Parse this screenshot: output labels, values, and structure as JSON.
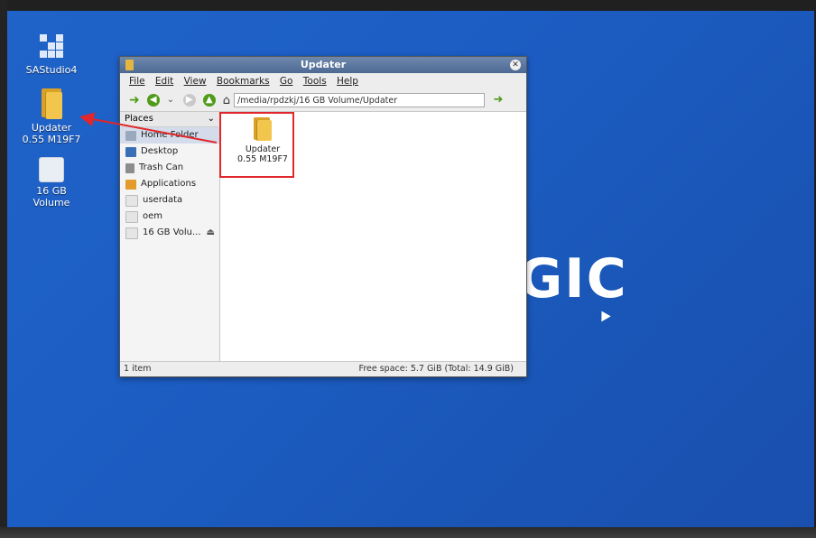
{
  "desktop": {
    "icons": [
      {
        "label": "SAStudio4"
      },
      {
        "label": "Updater\n0.55 M19F7",
        "line1": "Updater",
        "line2": "0.55 M19F7"
      },
      {
        "label": "16 GB Volume",
        "line1": "16 GB",
        "line2": "Volume"
      }
    ],
    "background_text": "GIC"
  },
  "window": {
    "title": "Updater",
    "menu": [
      "File",
      "Edit",
      "View",
      "Bookmarks",
      "Go",
      "Tools",
      "Help"
    ],
    "path": "/media/rpdzkj/16 GB Volume/Updater",
    "sidebar": {
      "header": "Places",
      "items": [
        {
          "label": "Home Folder",
          "icon": "home-icon"
        },
        {
          "label": "Desktop",
          "icon": "desktop-icon"
        },
        {
          "label": "Trash Can",
          "icon": "trash-icon"
        },
        {
          "label": "Applications",
          "icon": "applications-icon"
        },
        {
          "label": "userdata",
          "icon": "drive-icon"
        },
        {
          "label": "oem",
          "icon": "drive-icon"
        },
        {
          "label": "16 GB Volu...",
          "icon": "drive-icon"
        }
      ]
    },
    "files": [
      {
        "line1": "Updater",
        "line2": "0.55 M19F7"
      }
    ],
    "status": {
      "count": "1 item",
      "free": "Free space: 5.7 GiB (Total: 14.9 GiB)"
    }
  },
  "colors": {
    "desktop_bg": "#1c5dc3",
    "titlebar": "#5b779f",
    "highlight": "#e0272b",
    "folder": "#f2c64c"
  }
}
